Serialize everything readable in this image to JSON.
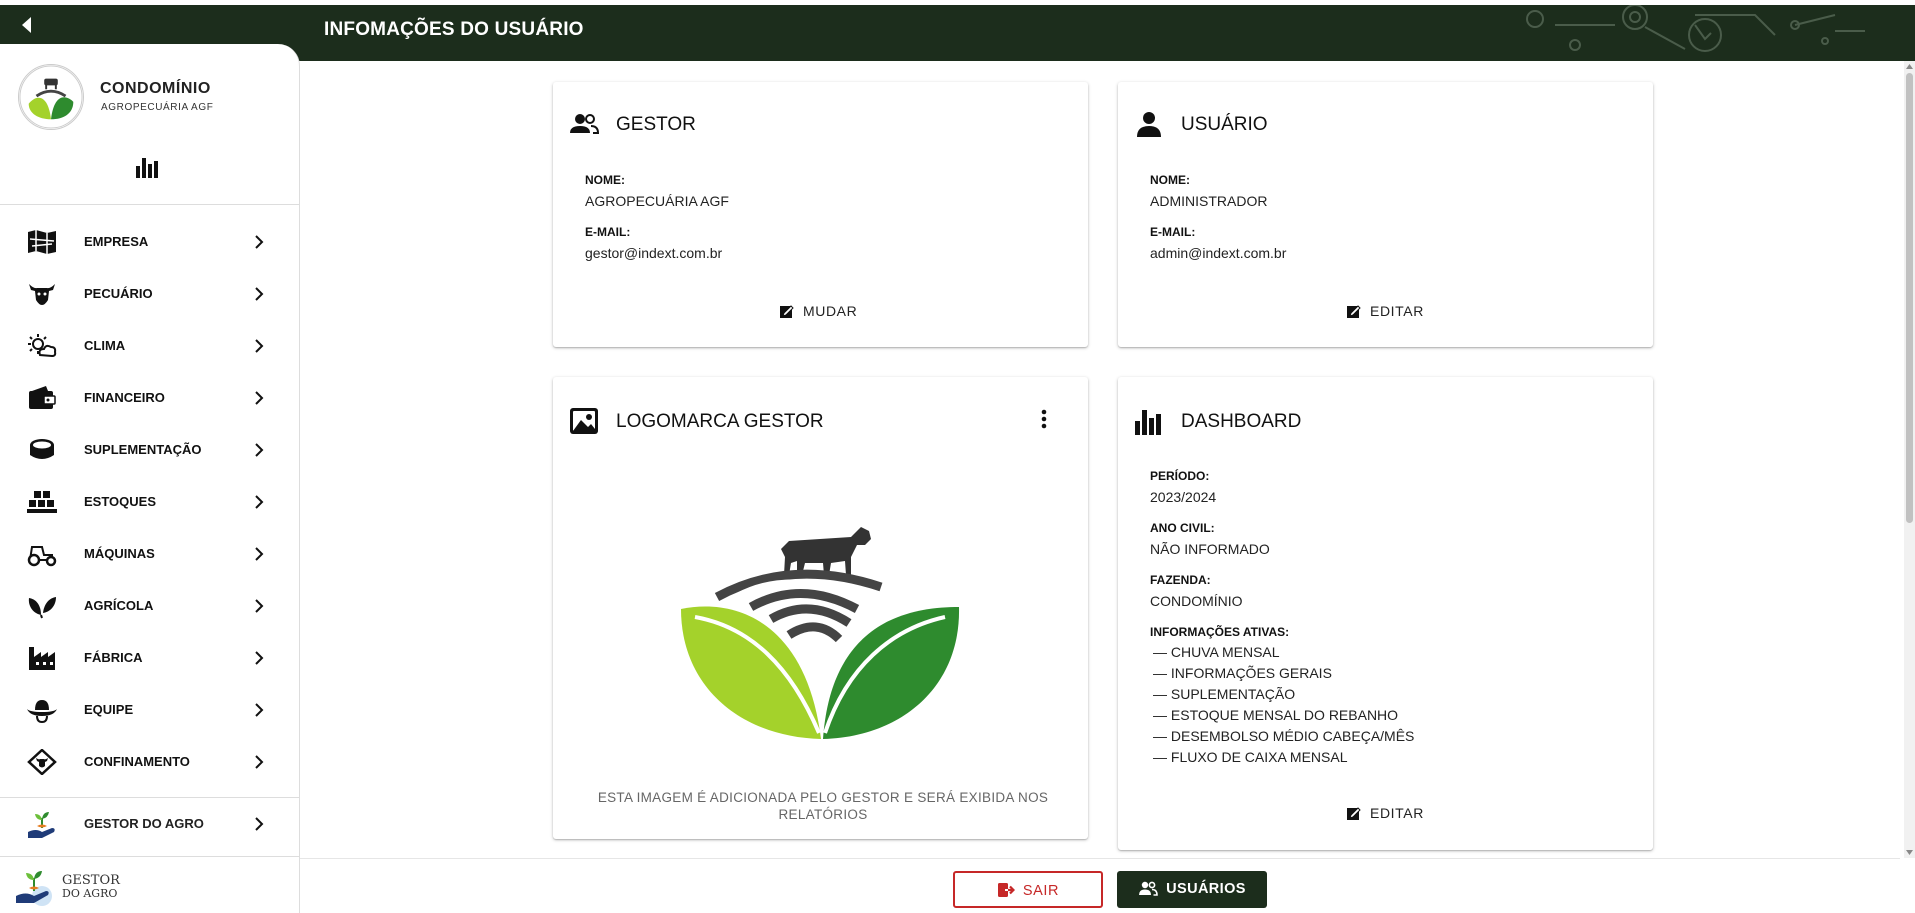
{
  "header": {
    "title": "INFOMAÇÕES DO USUÁRIO",
    "back_icon": "back-arrow-icon",
    "colors": {
      "bar": "#1c2d1c",
      "accent": "#c62828"
    }
  },
  "sidebar": {
    "brand_name": "CONDOMÍNIO",
    "brand_sub": "AGROPECUÁRIA AGF",
    "items": [
      {
        "label": "EMPRESA",
        "icon": "map-icon"
      },
      {
        "label": "PECUÁRIO",
        "icon": "cow-icon"
      },
      {
        "label": "CLIMA",
        "icon": "weather-icon"
      },
      {
        "label": "FINANCEIRO",
        "icon": "wallet-icon"
      },
      {
        "label": "SUPLEMENTAÇÃO",
        "icon": "feed-bag-icon"
      },
      {
        "label": "ESTOQUES",
        "icon": "warehouse-icon"
      },
      {
        "label": "MÁQUINAS",
        "icon": "tractor-icon"
      },
      {
        "label": "AGRÍCOLA",
        "icon": "leaves-icon"
      },
      {
        "label": "FÁBRICA",
        "icon": "factory-icon"
      },
      {
        "label": "EQUIPE",
        "icon": "cowboy-hat-icon"
      },
      {
        "label": "CONFINAMENTO",
        "icon": "confinement-icon"
      }
    ],
    "gestor": {
      "label": "GESTOR DO AGRO",
      "icon": "hand-plant-icon"
    },
    "footer_logo": {
      "line1": "GESTOR",
      "line2": "DO AGRO"
    }
  },
  "cards": {
    "gestor": {
      "title": "GESTOR",
      "name_label": "NOME:",
      "name": "AGROPECUÁRIA AGF",
      "email_label": "E-MAIL:",
      "email": "gestor@indext.com.br",
      "action": "MUDAR"
    },
    "usuario": {
      "title": "USUÁRIO",
      "name_label": "NOME:",
      "name": "ADMINISTRADOR",
      "email_label": "E-MAIL:",
      "email": "admin@indext.com.br",
      "action": "EDITAR"
    },
    "logomarca": {
      "title": "LOGOMARCA GESTOR",
      "caption": "ESTA IMAGEM É ADICIONADA PELO GESTOR E SERÁ EXIBIDA NOS RELATÓRIOS"
    },
    "dashboard": {
      "title": "DASHBOARD",
      "periodo_label": "PERÍODO:",
      "periodo": "2023/2024",
      "ano_label": "ANO CIVIL:",
      "ano": "NÃO INFORMADO",
      "fazenda_label": "FAZENDA:",
      "fazenda": "CONDOMÍNIO",
      "info_label": "INFORMAÇÕES ATIVAS:",
      "info_items": [
        "— CHUVA MENSAL",
        "— INFORMAÇÕES GERAIS",
        "— SUPLEMENTAÇÃO",
        "— ESTOQUE MENSAL DO REBANHO",
        "— DESEMBOLSO MÉDIO CABEÇA/MÊS",
        "— FLUXO DE CAIXA MENSAL"
      ],
      "action": "EDITAR"
    }
  },
  "footer": {
    "sair": "SAIR",
    "usuarios": "USUÁRIOS"
  }
}
